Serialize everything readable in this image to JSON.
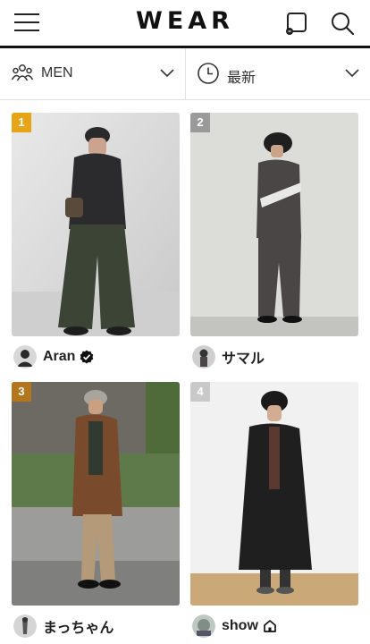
{
  "header": {
    "logo": "WEAR",
    "icons": [
      "menu-icon",
      "coordinate-post-icon",
      "search-icon"
    ]
  },
  "filters": {
    "gender": {
      "label": "MEN",
      "icon": "people-icon"
    },
    "sort": {
      "label": "最新",
      "icon": "clock-icon"
    }
  },
  "posts": [
    {
      "rank": "1",
      "user": "Aran",
      "badge": "verified-badge-icon",
      "rank_color": "#e6a417"
    },
    {
      "rank": "2",
      "user": "サマル",
      "badge": "",
      "rank_color": "#9a9a9a"
    },
    {
      "rank": "3",
      "user": "まっちゃん",
      "badge": "",
      "rank_color": "#b4761c"
    },
    {
      "rank": "4",
      "user": "show",
      "badge": "shop-badge-icon",
      "rank_color": "#c9c9c9"
    }
  ],
  "colors": {
    "accent": "#111111",
    "divider": "#e2e2e2"
  }
}
